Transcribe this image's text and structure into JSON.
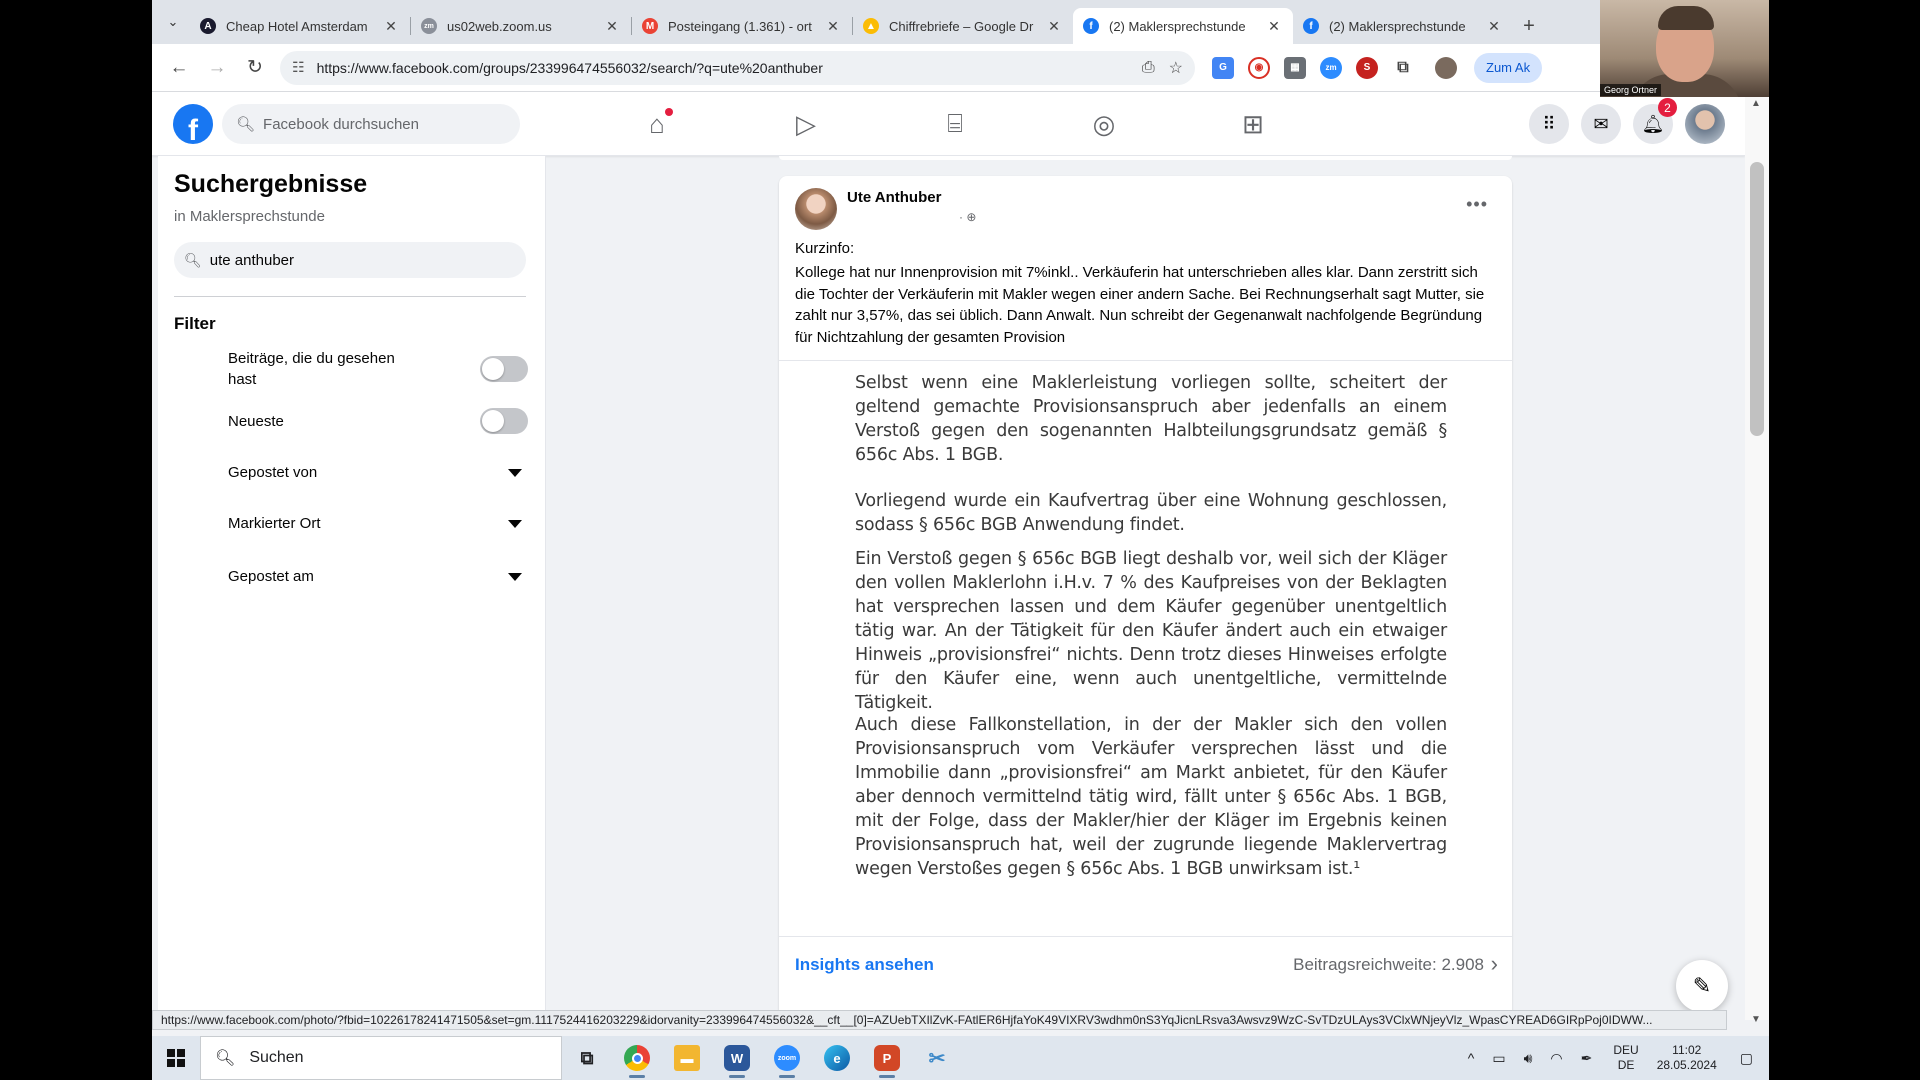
{
  "browser": {
    "tabs": [
      {
        "title": "Cheap Hotel Amsterdam",
        "fav_color": "#1a1a2e",
        "fav_char": "A"
      },
      {
        "title": "us02web.zoom.us",
        "fav_color": "#8a8f99",
        "fav_char": "zm"
      },
      {
        "title": "Posteingang (1.361) - ort",
        "fav_color": "#ea4335",
        "fav_char": "M"
      },
      {
        "title": "Chiffrebriefe – Google Dr",
        "fav_color": "#fbbc04",
        "fav_char": "▲"
      },
      {
        "title": "(2) Maklersprechstunde",
        "fav_color": "#1877f2",
        "fav_char": "f"
      },
      {
        "title": "(2) Maklersprechstunde",
        "fav_color": "#1877f2",
        "fav_char": "f"
      }
    ],
    "active_tab": 4,
    "url": "https://www.facebook.com/groups/233996474556032/search/?q=ute%20anthuber",
    "zum_button": "Zum Ak"
  },
  "facebook": {
    "logo": "f",
    "search_placeholder": "Facebook durchsuchen",
    "nav_icons": [
      "home-icon",
      "video-icon",
      "marketplace-icon",
      "groups-icon",
      "gaming-icon"
    ],
    "notifications_count": "2"
  },
  "sidebar": {
    "title": "Suchergebnisse",
    "subtitle": "in Maklersprechstunde",
    "search_value": "ute anthuber",
    "filter_heading": "Filter",
    "filters": {
      "seen": "Beiträge, die du gesehen hast",
      "newest": "Neueste",
      "posted_by": "Gepostet von",
      "tagged_location": "Markierter Ort",
      "posted_on": "Gepostet am"
    }
  },
  "post": {
    "author": "Ute Anthuber",
    "meta": "·",
    "kurzinfo_label": "Kurzinfo:",
    "kurzinfo_text": "Kollege hat nur Innenprovision mit 7%inkl.. Verkäuferin hat unterschrieben alles klar. Dann zerstritt sich die Tochter der Verkäuferin mit Makler wegen einer andern Sache. Bei Rechnungserhalt sagt Mutter, sie zahlt nur 3,57%, das sei üblich. Dann Anwalt. Nun schreibt der Gegenanwalt nachfolgende Begründung für Nichtzahlung der gesamten Provision",
    "document": [
      "Selbst wenn eine Maklerleistung vorliegen sollte, scheitert der geltend gemachte Provisionsanspruch aber jedenfalls an einem Verstoß gegen den sogenannten Halbteilungsgrundsatz gemäß § 656c Abs. 1 BGB.",
      "Vorliegend wurde ein Kaufvertrag über eine Wohnung geschlossen, sodass § 656c BGB Anwendung findet.",
      "Ein Verstoß gegen § 656c BGB liegt deshalb vor, weil sich der Kläger den vollen Maklerlohn i.H.v. 7 % des Kaufpreises von der Beklagten hat versprechen lassen und dem Käufer gegenüber unentgeltlich tätig war. An der Tätigkeit für den Käufer ändert auch ein etwaiger Hinweis „provisionsfrei“ nichts. Denn trotz dieses Hinweises erfolgte für den Käufer eine, wenn auch unentgeltliche, vermittelnde Tätigkeit.",
      "Auch diese Fallkonstellation, in der der Makler sich den vollen Provisionsanspruch vom Verkäufer versprechen lässt und die Immobilie dann „provisionsfrei“ am Markt anbietet, für den Käufer aber dennoch vermittelnd tätig wird, fällt unter § 656c Abs. 1 BGB, mit der Folge, dass der Makler/hier der Kläger im Ergebnis keinen Provisionsanspruch hat, weil der zugrunde liegende Maklervertrag wegen Verstoßes gegen § 656c Abs. 1 BGB unwirksam ist.¹"
    ],
    "insights_link": "Insights ansehen",
    "reach": "Beitragsreichweite: 2.908"
  },
  "status_url": "https://www.facebook.com/photo/?fbid=10226178241471505&set=gm.1117524416203229&idorvanity=233996474556032&__cft__[0]=AZUebTXIlZvK-FAtlER6HjfaYoK49VIXRV3wdhm0nS3YqJicnLRsva3Awsvz9WzC-SvTDzULAys3VClxWNjeyVlz_WpasCYREAD6GIRpPoj0IDWW...",
  "taskbar": {
    "search_label": "Suchen",
    "apps": [
      {
        "name": "task-view",
        "color": "#dfe6ee",
        "char": "⧉",
        "open": false
      },
      {
        "name": "chrome",
        "color": "#4285f4",
        "char": "●",
        "open": true
      },
      {
        "name": "file-explorer",
        "color": "#f2b630",
        "char": "▬",
        "open": false
      },
      {
        "name": "word",
        "color": "#2b579a",
        "char": "W",
        "open": true
      },
      {
        "name": "zoom",
        "color": "#2d8cff",
        "char": "zoom",
        "open": true
      },
      {
        "name": "edge",
        "color": "#0c8ed9",
        "char": "e",
        "open": false
      },
      {
        "name": "powerpoint",
        "color": "#d24726",
        "char": "P",
        "open": true
      },
      {
        "name": "snipping",
        "color": "#6cb4e4",
        "char": "✂",
        "open": false
      }
    ],
    "lang_top": "DEU",
    "lang_bottom": "DE",
    "time": "11:02",
    "date": "28.05.2024"
  },
  "webcam": {
    "name": "Georg Ortner"
  }
}
